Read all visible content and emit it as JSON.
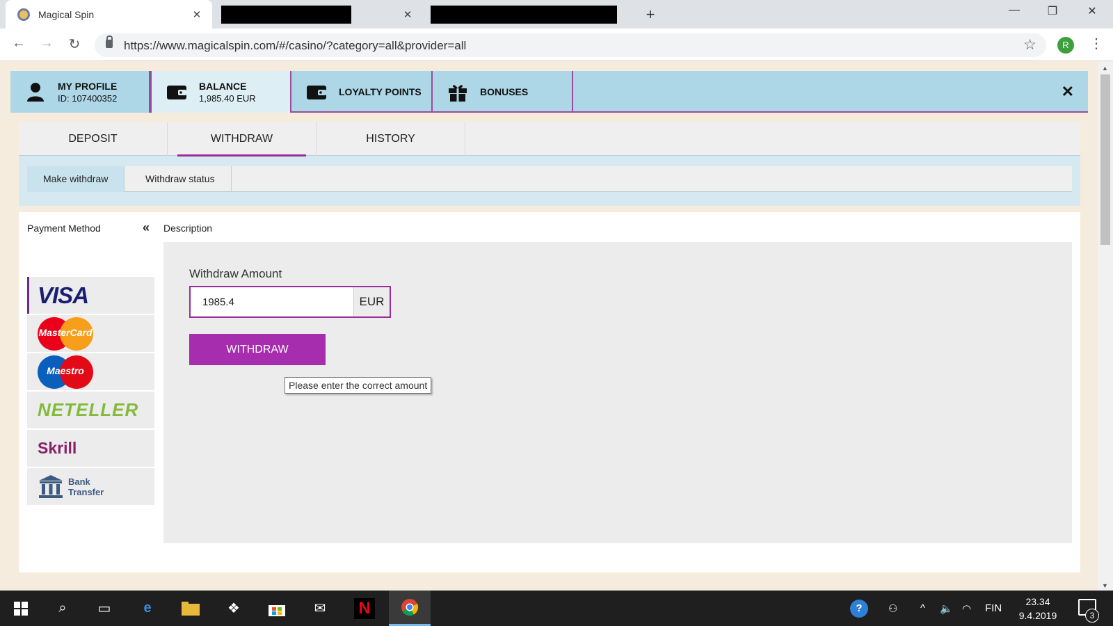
{
  "browser": {
    "active_tab_title": "Magical Spin",
    "url": "https://www.magicalspin.com/#/casino/?category=all&provider=all",
    "profile_initial": "R"
  },
  "account_header": {
    "profile": {
      "label": "MY PROFILE",
      "id": "ID: 107400352"
    },
    "balance": {
      "label": "BALANCE",
      "value": "1,985.40 EUR"
    },
    "loyalty": {
      "label": "LOYALTY POINTS"
    },
    "bonuses": {
      "label": "BONUSES"
    }
  },
  "main_tabs": [
    {
      "label": "DEPOSIT"
    },
    {
      "label": "WITHDRAW"
    },
    {
      "label": "HISTORY"
    }
  ],
  "sub_tabs": [
    {
      "label": "Make withdraw"
    },
    {
      "label": "Withdraw status"
    }
  ],
  "content": {
    "payment_method_label": "Payment Method",
    "collapse_glyph": "«",
    "description_label": "Description"
  },
  "payment_methods": [
    {
      "name": "VISA",
      "icon": "visa-logo"
    },
    {
      "name": "MasterCard",
      "icon": "mastercard-logo"
    },
    {
      "name": "Maestro",
      "icon": "maestro-logo"
    },
    {
      "name": "NETELLER",
      "icon": "neteller-logo"
    },
    {
      "name": "Skrill",
      "icon": "skrill-logo"
    },
    {
      "name": "Bank Transfer",
      "line1": "Bank",
      "line2": "Transfer",
      "icon": "bank-icon"
    }
  ],
  "withdraw_form": {
    "label": "Withdraw Amount",
    "amount_value": "1985.4",
    "currency": "EUR",
    "button_label": "WITHDRAW",
    "tooltip": "Please enter the correct amount"
  },
  "taskbar": {
    "language": "FIN",
    "time": "23.34",
    "date": "9.4.2019",
    "notification_count": "3"
  },
  "colors": {
    "accent_purple": "#a72daf",
    "header_blue": "#add7e6"
  }
}
